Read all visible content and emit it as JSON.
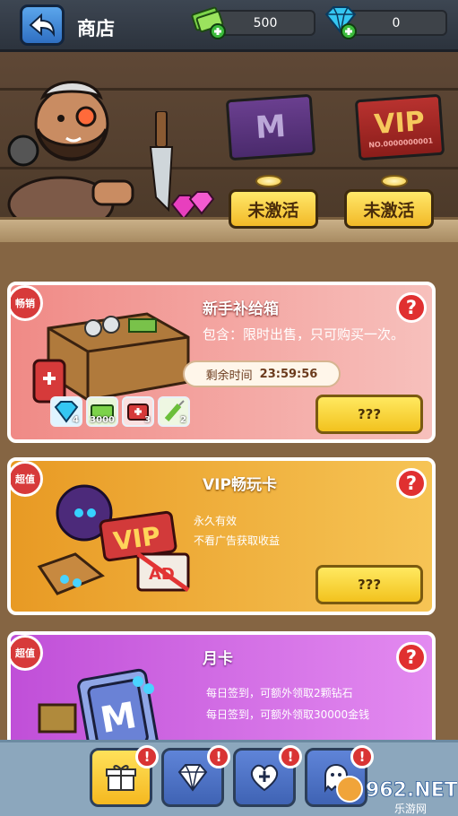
{
  "header": {
    "title": "商店",
    "cash": "500",
    "diamonds": "0"
  },
  "membership": {
    "month_card_sign": "M",
    "vip_card_sign": "VIP",
    "vip_card_serial": "NO.0000000001",
    "month_status": "未激活",
    "vip_status": "未激活"
  },
  "cards": {
    "starter": {
      "tag": "畅销",
      "title": "新手补给箱",
      "desc": "包含：限时出售，只可购买一次。",
      "timer_label": "剩余时间",
      "timer_value": "23:59:56",
      "price": "???",
      "help": "?",
      "items": [
        {
          "icon": "diamond-icon",
          "count": "4"
        },
        {
          "icon": "cash-icon",
          "count": "3000"
        },
        {
          "icon": "medkit-icon",
          "count": "3"
        },
        {
          "icon": "syringe-icon",
          "count": "2"
        }
      ]
    },
    "vip": {
      "tag": "超值",
      "title": "VIP畅玩卡",
      "line1": "永久有效",
      "line2": "不看广告获取收益",
      "price": "???",
      "help": "?",
      "art_text_vip": "VIP",
      "art_text_ad": "AD"
    },
    "month": {
      "tag": "超值",
      "title": "月卡",
      "line1": "每日签到，可额外领取2颗钻石",
      "line2": "每日签到，可额外领取30000金钱",
      "help": "?",
      "art_text": "M"
    }
  },
  "tabs": {
    "badge": "!"
  },
  "watermark": {
    "text": "962.NET",
    "subtext": "乐游网"
  },
  "colors": {
    "accent_yellow": "#f2c21e",
    "help_red": "#e03030",
    "starter_bg": "#f4b3b0",
    "vip_bg": "#f0b43c",
    "month_bg": "#d46de6",
    "tab_active": "#f5c933",
    "tab_inactive": "#4f76c9"
  }
}
